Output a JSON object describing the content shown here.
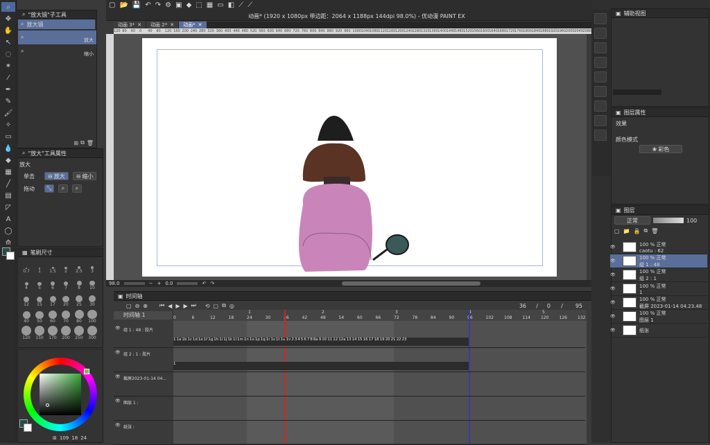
{
  "window": {
    "title": "动画* (1920 x 1080px 带边距：2064 x 1188px 144dpi 98.0%) - 优动漫 PAINT EX"
  },
  "tabs": [
    {
      "label": "动画 3*"
    },
    {
      "label": "动画 2*"
    },
    {
      "label": "动画*"
    }
  ],
  "ruler_ticks": [
    "120",
    "80",
    "40",
    "0",
    "40",
    "80",
    "120",
    "160",
    "200",
    "240",
    "280",
    "320",
    "360",
    "400",
    "440",
    "480",
    "520",
    "560",
    "600",
    "640",
    "680",
    "720",
    "760",
    "800",
    "840",
    "880",
    "920",
    "960",
    "1000",
    "1040",
    "1080",
    "1120",
    "1160",
    "1200",
    "1240",
    "1280",
    "1320",
    "1360",
    "1400",
    "1440",
    "1480",
    "1520",
    "1560",
    "1600",
    "1640",
    "1680",
    "1720",
    "1760",
    "1800",
    "1840",
    "1880",
    "1920",
    "1960",
    "2000",
    "2040",
    "2080"
  ],
  "subtool_panel": {
    "title": "\"放大镜\"子工具",
    "items": [
      {
        "label": "放大镜",
        "extra": ""
      },
      {
        "label": "",
        "extra": "放大"
      },
      {
        "label": "",
        "extra": "缩小"
      }
    ]
  },
  "tool_property": {
    "title": "\"放大\"工具属性",
    "section": "放大",
    "click_label": "单击",
    "click_zoom_in": "放大",
    "click_zoom_out": "缩小",
    "drag_label": "拖动"
  },
  "brush_size": {
    "title": "笔刷尺寸",
    "sizes": [
      "0.7",
      "1",
      "1.5",
      "2",
      "2.5",
      "3",
      "4",
      "5",
      "6",
      "7",
      "8",
      "10",
      "12",
      "15",
      "17",
      "20",
      "25",
      "30",
      "40",
      "50",
      "60",
      "70",
      "80",
      "100",
      "120",
      "150",
      "170",
      "200",
      "250",
      "300"
    ]
  },
  "color": {
    "main": "#7bc043",
    "sub": "#ffffff",
    "values": [
      "109",
      "18",
      "24"
    ]
  },
  "statusbar": {
    "zoom": "98.0",
    "angle": "0.0"
  },
  "timeline": {
    "title": "时间轴",
    "name": "时间轴 1",
    "current": "36",
    "start": "0",
    "end": "95",
    "frame_numbers": [
      "0",
      "6",
      "12",
      "18",
      "24",
      "30",
      "36",
      "42",
      "48",
      "54",
      "60",
      "66",
      "72",
      "78",
      "84",
      "90",
      "96",
      "102",
      "108",
      "114",
      "120",
      "126",
      "132"
    ],
    "sec_marks": [
      "1",
      "2",
      "3",
      "4",
      "5"
    ],
    "tracks": [
      {
        "name": "组 1 : 48 : 胶片",
        "cells": [
          "1",
          "1a",
          "1b",
          "1c",
          "1d",
          "1e",
          "1f",
          "1g",
          "1h",
          "1i",
          "1j",
          "1k",
          "1l",
          "1m",
          "1n",
          "1o",
          "1p",
          "1q",
          "1r",
          "1s",
          "1t",
          "1u",
          "1v",
          "2",
          "3",
          "4",
          "5",
          "6",
          "7",
          "8",
          "8a",
          "9",
          "10",
          "11",
          "12",
          "12a",
          "13",
          "14",
          "15",
          "16",
          "17",
          "18",
          "19",
          "20",
          "21",
          "22",
          "23"
        ]
      },
      {
        "name": "组 2 : 1 : 胶片",
        "cells": [
          "1"
        ]
      },
      {
        "name": "截屏2023-01-14 04...",
        "cells": []
      },
      {
        "name": "图层 1 :",
        "cells": []
      },
      {
        "name": "纸张 :",
        "cells": []
      }
    ]
  },
  "nav_panel": {
    "title": "辅助视图"
  },
  "layer_property": {
    "title": "图层属性",
    "effect_label": "效果",
    "color_mode_label": "颜色模式",
    "color_mode_value": "彩色"
  },
  "layers_panel": {
    "title": "图层",
    "blend": "正常",
    "opacity": "100",
    "layers": [
      {
        "line1": "100 % 正常",
        "line2": "caotu : 62"
      },
      {
        "line1": "100 % 正常",
        "line2": "组 1 : 48"
      },
      {
        "line1": "100 % 正常",
        "line2": "组 2 : 1"
      },
      {
        "line1": "100 % 正常",
        "line2": "1"
      },
      {
        "line1": "100 % 正常",
        "line2": "截屏 2023-01-14 04.23.48"
      },
      {
        "line1": "100 % 正常",
        "line2": "图层 1"
      },
      {
        "line1": "",
        "line2": "纸张"
      }
    ]
  }
}
